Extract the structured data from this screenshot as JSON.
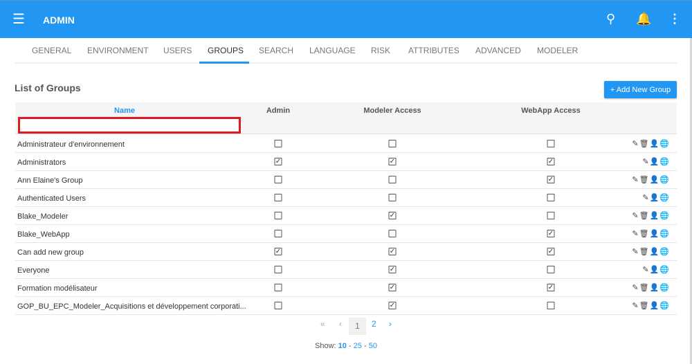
{
  "header": {
    "title": "ADMIN"
  },
  "tabs": [
    "GENERAL",
    "ENVIRONMENT",
    "USERS",
    "GROUPS",
    "SEARCH",
    "LANGUAGE",
    "RISK",
    "ATTRIBUTES",
    "ADVANCED",
    "MODELER"
  ],
  "active_tab": "GROUPS",
  "section_title": "List of Groups",
  "add_button": "+ Add New Group",
  "columns": {
    "name": "Name",
    "admin": "Admin",
    "modeler": "Modeler Access",
    "webapp": "WebApp Access"
  },
  "rows": [
    {
      "name": "Administrateur d'environnement",
      "admin": false,
      "modeler": false,
      "webapp": false,
      "delete": true
    },
    {
      "name": "Administrators",
      "admin": true,
      "modeler": true,
      "webapp": true,
      "delete": false
    },
    {
      "name": "Ann Elaine's Group",
      "admin": false,
      "modeler": false,
      "webapp": true,
      "delete": true
    },
    {
      "name": "Authenticated Users",
      "admin": false,
      "modeler": false,
      "webapp": false,
      "delete": false
    },
    {
      "name": "Blake_Modeler",
      "admin": false,
      "modeler": true,
      "webapp": false,
      "delete": true
    },
    {
      "name": "Blake_WebApp",
      "admin": false,
      "modeler": false,
      "webapp": true,
      "delete": true
    },
    {
      "name": "Can add new group",
      "admin": true,
      "modeler": true,
      "webapp": true,
      "delete": true
    },
    {
      "name": "Everyone",
      "admin": false,
      "modeler": true,
      "webapp": false,
      "delete": false
    },
    {
      "name": "Formation modélisateur",
      "admin": false,
      "modeler": true,
      "webapp": true,
      "delete": true
    },
    {
      "name": "GOP_BU_EPC_Modeler_Acquisitions et développement corporati...",
      "admin": false,
      "modeler": true,
      "webapp": false,
      "delete": true
    }
  ],
  "pagination": {
    "first": "«",
    "prev": "‹",
    "pages": [
      "1",
      "2"
    ],
    "current": "1",
    "next": "›"
  },
  "show": {
    "label": "Show:",
    "options": [
      "10",
      "25",
      "50"
    ],
    "selected": "10"
  }
}
